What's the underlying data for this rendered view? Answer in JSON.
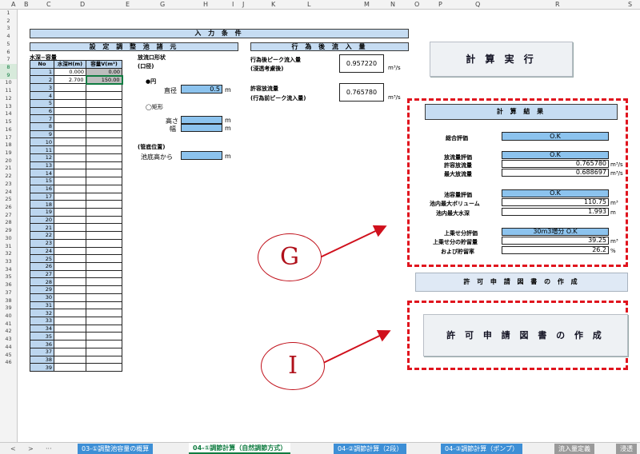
{
  "columns": [
    "A",
    "B",
    "C",
    "D",
    "E",
    "G",
    "H",
    "I",
    "J",
    "K",
    "L",
    "M",
    "N",
    "O",
    "P",
    "Q",
    "R",
    "S"
  ],
  "rows": [
    "1",
    "2",
    "3",
    "4",
    "5",
    "6",
    "7",
    "8",
    "9",
    "10",
    "11",
    "12",
    "13",
    "14",
    "15",
    "16",
    "17",
    "18",
    "19",
    "20",
    "21",
    "22",
    "23",
    "24",
    "25",
    "26",
    "27",
    "28",
    "29",
    "30",
    "31",
    "32",
    "33",
    "34",
    "35",
    "36",
    "37",
    "38",
    "39",
    "40",
    "41",
    "42",
    "43",
    "44",
    "45",
    "46"
  ],
  "input_conditions_title": "入 力 条 件",
  "pond": {
    "title": "設 定 調 整 池 諸 元",
    "table_caption": "水深−容量",
    "headers": [
      "No",
      "水深H(m)",
      "容量V(m³)"
    ],
    "rows": [
      {
        "no": "1",
        "h": "0.000",
        "v": "0.00"
      },
      {
        "no": "2",
        "h": "2.700",
        "v": "150.00"
      }
    ],
    "empty_numbers": [
      "3",
      "4",
      "5",
      "6",
      "7",
      "8",
      "9",
      "10",
      "11",
      "12",
      "13",
      "14",
      "15",
      "16",
      "17",
      "18",
      "19",
      "20",
      "21",
      "22",
      "23",
      "24",
      "25",
      "26",
      "27",
      "28",
      "29",
      "30",
      "31",
      "32",
      "33",
      "34",
      "35",
      "36",
      "37",
      "38",
      "39"
    ]
  },
  "outlet": {
    "shape_label": "放流口形状",
    "shape_sub": "(口径)",
    "circle_label": "●円",
    "diameter_label": "直径",
    "diameter_value": "0.5",
    "diameter_unit": "m",
    "rect_label": "◯矩形",
    "height_label": "高さ",
    "height_unit": "m",
    "width_label": "幅",
    "width_unit": "m",
    "pipe_pos_label": "(管底位置)",
    "pipe_from_label": "池底高から",
    "pipe_unit": "m"
  },
  "flow": {
    "title": "行 為 後 流 入 量",
    "after_label_1": "行為後ピーク流入量",
    "after_label_2": "(浸透考慮後)",
    "after_value": "0.957220",
    "after_unit": "m³/s",
    "allow_label_1": "許容放流量",
    "allow_label_2": "(行為前ピーク流入量)",
    "allow_value": "0.765780",
    "allow_unit": "m³/s"
  },
  "run_button": "計 算 実 行",
  "results": {
    "title": "計 算 結 果",
    "overall_label": "総合評価",
    "overall_value": "O.K",
    "discharge_eval_label": "放流量評価",
    "discharge_eval_value": "O.K",
    "allowed_label": "許容放流量",
    "allowed_value": "0.765780",
    "allowed_unit": "m³/s",
    "max_label": "最大放流量",
    "max_value": "0.688697",
    "max_unit": "m³/s",
    "pond_eval_label": "池容量評価",
    "pond_eval_value": "O.K",
    "max_vol_label": "池内最大ボリューム",
    "max_vol_value": "110.75",
    "max_vol_unit": "m³",
    "max_depth_label": "池内最大水深",
    "max_depth_value": "1.993",
    "max_depth_unit": "m",
    "extra_eval_label": "上乗せ分評価",
    "extra_eval_value": "30m3増分 O.K",
    "extra_storage_label": "上乗せ分の貯留量",
    "extra_storage_value": "39.25",
    "extra_storage_unit": "m³",
    "storage_rate_label": "および貯留率",
    "storage_rate_value": "26.2",
    "storage_rate_unit": "%"
  },
  "permit_bar": "許 可 申 請 図 書 の 作 成",
  "permit_button": "許 可 申 請 図 書 の 作 成",
  "callouts": {
    "g": "G",
    "i": "I"
  },
  "sheet_tabs": {
    "nav_prev": "<",
    "nav_next": ">",
    "nav_more": "···",
    "tabs": [
      "03-①調整池容量の概算",
      "04-①調節計算（自然調節方式）",
      "04-②調節計算（2段）",
      "04-③調節計算（ポンプ）",
      "流入量定義",
      "浸透"
    ]
  },
  "colors": {
    "accent_red": "#e0141e",
    "blue_cell": "#8cc3ee",
    "blue_header": "#bcd6ef",
    "tab_blue": "#3d8fd6"
  }
}
